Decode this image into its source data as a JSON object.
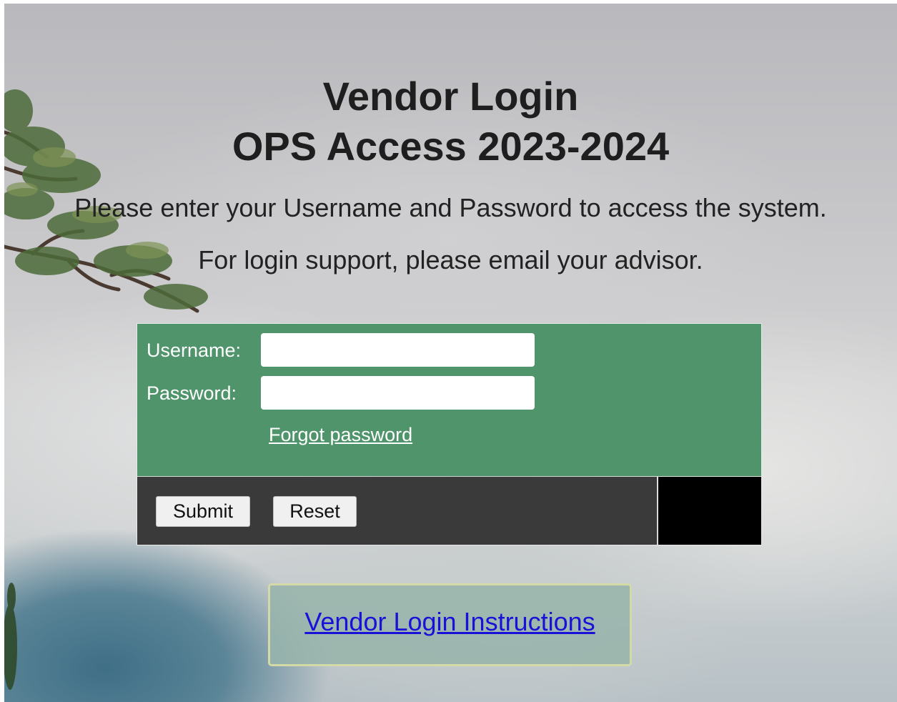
{
  "header": {
    "title_line1": "Vendor Login",
    "title_line2": "OPS Access 2023-2024",
    "instructions": "Please enter your Username and Password to access the system.",
    "support": "For login support, please email your advisor."
  },
  "login_form": {
    "username_label": "Username:",
    "username_value": "",
    "password_label": "Password:",
    "password_value": "",
    "forgot_password_link": "Forgot password",
    "submit_label": "Submit",
    "reset_label": "Reset",
    "colors": {
      "form_background": "#4f946b",
      "button_bar_background": "#3a3a3a",
      "corner_block": "#000000"
    }
  },
  "instructions_link": {
    "label": "Vendor Login Instructions",
    "color": "#1a10d8"
  }
}
